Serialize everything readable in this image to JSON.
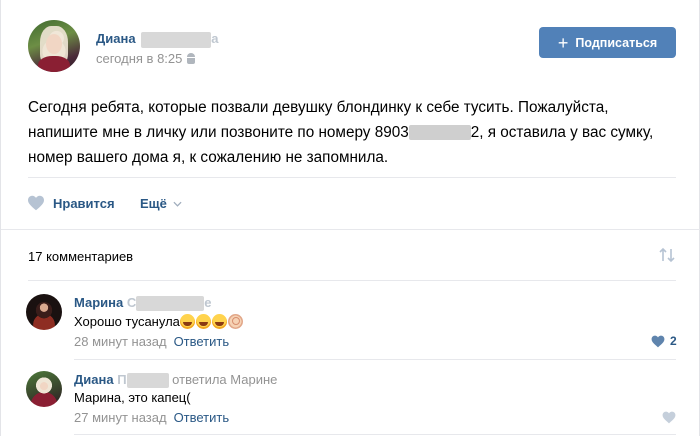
{
  "post": {
    "author_first_name": "Диана",
    "author_name_tail": "а",
    "time": "сегодня в 8:25",
    "subscribe_label": "Подписаться",
    "text_part1": "Сегодня ребята, которые позвали девушку блондинку к себе тусить. Пожалуйста, напишите мне в личку или позвоните по номеру 8903",
    "text_part2": "2, я оставила у вас сумку, номер вашего дома я, к сожалению не запомнила.",
    "like_label": "Нравится",
    "more_label": "Ещё"
  },
  "comments_header": {
    "count_label": "17 комментариев"
  },
  "comments": [
    {
      "name_first": "Марина",
      "name_prefix_letter": "С",
      "name_tail": "е",
      "text": "Хорошо тусанула",
      "emojis": [
        "face-with-tears-of-joy-icon",
        "face-with-tears-of-joy-icon",
        "face-with-tears-of-joy-icon",
        "ok-hand-icon"
      ],
      "time": "28 минут назад",
      "reply_label": "Ответить",
      "likes": "2"
    },
    {
      "name_first": "Диана",
      "name_prefix_letter": "П",
      "replied_to": "ответила Марине",
      "text": "Марина, это капец(",
      "time": "27 минут назад",
      "reply_label": "Ответить"
    }
  ],
  "colors": {
    "link": "#2a5885",
    "button": "#5181b8",
    "muted": "#939393",
    "divider": "#e7e8ec"
  }
}
